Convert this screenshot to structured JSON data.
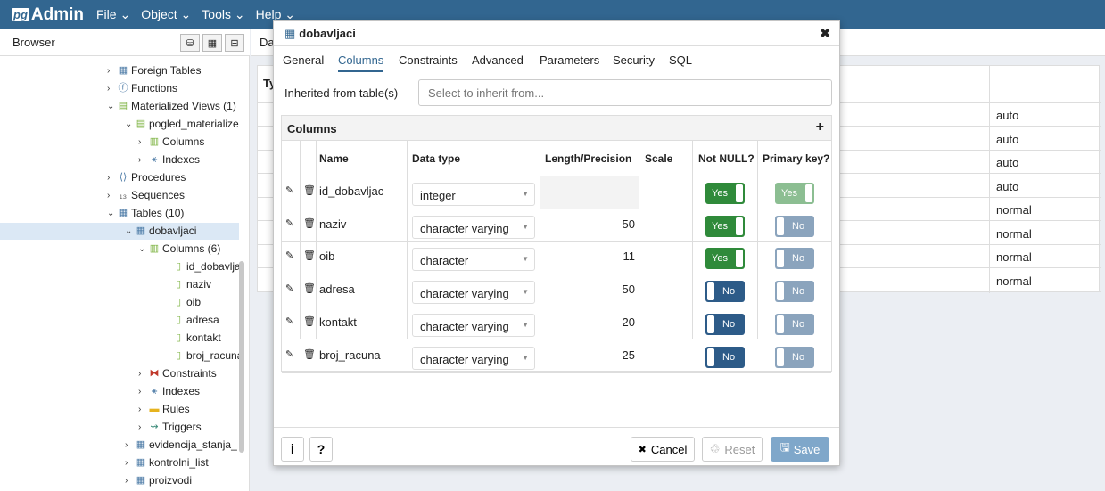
{
  "app": {
    "logo_badge": "pg",
    "logo_text": "Admin",
    "menu": [
      "File ⌄",
      "Object ⌄",
      "Tools ⌄",
      "Help ⌄"
    ]
  },
  "browser": {
    "title": "Browser",
    "tree": [
      {
        "label": "Foreign Tables",
        "icon": "foreign-table-icon",
        "arrow": "›"
      },
      {
        "label": "Functions",
        "icon": "function-icon",
        "arrow": "›"
      },
      {
        "label": "Materialized Views (1)",
        "icon": "mview-icon",
        "arrow": "⌄"
      },
      {
        "label": "pogled_materialize",
        "icon": "mview-icon",
        "arrow": "⌄"
      },
      {
        "label": "Columns",
        "icon": "columns-icon",
        "arrow": "›"
      },
      {
        "label": "Indexes",
        "icon": "index-icon",
        "arrow": "›"
      },
      {
        "label": "Procedures",
        "icon": "procedure-icon",
        "arrow": "›"
      },
      {
        "label": "Sequences",
        "icon": "sequence-icon",
        "arrow": "›"
      },
      {
        "label": "Tables (10)",
        "icon": "table-icon",
        "arrow": "⌄"
      },
      {
        "label": "dobavljaci",
        "icon": "table-icon",
        "arrow": "⌄"
      },
      {
        "label": "Columns (6)",
        "icon": "columns-icon",
        "arrow": "⌄"
      },
      {
        "label": "id_dobavlja",
        "icon": "column-icon",
        "arrow": ""
      },
      {
        "label": "naziv",
        "icon": "column-icon",
        "arrow": ""
      },
      {
        "label": "oib",
        "icon": "column-icon",
        "arrow": ""
      },
      {
        "label": "adresa",
        "icon": "column-icon",
        "arrow": ""
      },
      {
        "label": "kontakt",
        "icon": "column-icon",
        "arrow": ""
      },
      {
        "label": "broj_racuna",
        "icon": "column-icon",
        "arrow": ""
      },
      {
        "label": "Constraints",
        "icon": "constraint-icon",
        "arrow": "›"
      },
      {
        "label": "Indexes",
        "icon": "index-icon",
        "arrow": "›"
      },
      {
        "label": "Rules",
        "icon": "rule-icon",
        "arrow": "›"
      },
      {
        "label": "Triggers",
        "icon": "trigger-icon",
        "arrow": "›"
      },
      {
        "label": "evidencija_stanja_",
        "icon": "table-icon",
        "arrow": "›"
      },
      {
        "label": "kontrolni_list",
        "icon": "table-icon",
        "arrow": "›"
      },
      {
        "label": "proizvodi",
        "icon": "table-icon",
        "arrow": "›"
      }
    ]
  },
  "right_panel": {
    "tab_label": "Da",
    "header_label": "Ty",
    "grid_values": [
      "auto",
      "auto",
      "auto",
      "auto",
      "normal",
      "normal",
      "normal",
      "normal"
    ]
  },
  "dialog": {
    "title": "dobavljaci",
    "tabs": [
      "General",
      "Columns",
      "Constraints",
      "Advanced",
      "Parameters",
      "Security",
      "SQL"
    ],
    "active_tab": "Columns",
    "inherited_label": "Inherited from table(s)",
    "inherited_placeholder": "Select to inherit from...",
    "columns_section": "Columns",
    "headers": {
      "name": "Name",
      "data_type": "Data type",
      "length": "Length/Precision",
      "scale": "Scale",
      "not_null": "Not NULL?",
      "pk": "Primary key?"
    },
    "rows": [
      {
        "name": "id_dobavljac",
        "type": "integer",
        "length": "",
        "not_null": "Yes",
        "pk": "Yes"
      },
      {
        "name": "naziv",
        "type": "character varying",
        "length": "50",
        "not_null": "Yes",
        "pk": "No"
      },
      {
        "name": "oib",
        "type": "character",
        "length": "11",
        "not_null": "Yes",
        "pk": "No"
      },
      {
        "name": "adresa",
        "type": "character varying",
        "length": "50",
        "not_null": "No",
        "pk": "No"
      },
      {
        "name": "kontakt",
        "type": "character varying",
        "length": "20",
        "not_null": "No",
        "pk": "No"
      },
      {
        "name": "broj_racuna",
        "type": "character varying",
        "length": "25",
        "not_null": "No",
        "pk": "No"
      }
    ],
    "footer": {
      "info": "i",
      "help": "?",
      "cancel": "Cancel",
      "reset": "Reset",
      "save": "Save"
    }
  }
}
